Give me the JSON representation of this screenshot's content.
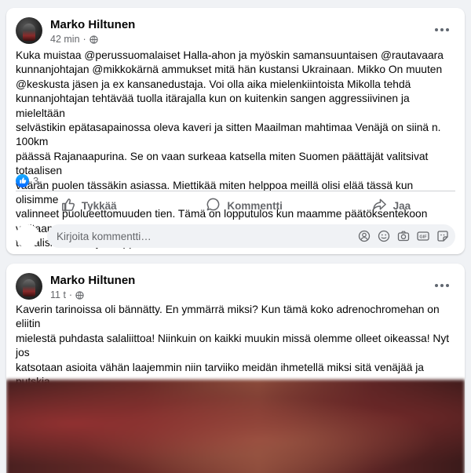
{
  "posts": [
    {
      "author": "Marko Hiltunen",
      "time": "42 min",
      "separator": "·",
      "text": "Kuka muistaa @perussuomalaiset Halla-ahon ja myöskin samansuuntaisen @rautavaara\nkunnanjohtajan @mikkokärnä ammukset mitä hän kustansi Ukrainaan. Mikko On muuten\n@keskusta jäsen ja ex kansanedustaja. Voi olla aika mielenkiintoista Mikolla tehdä\nkunnanjohtajan tehtävää tuolla itärajalla kun on kuitenkin sangen aggressiivinen ja mieleltään\nselvästikin epätasapainossa oleva kaveri ja sitten Maailman mahtimaa Venäjä on siinä n. 100km\npäässä Rajanaapurina. Se on vaan surkeaa katsella miten Suomen päättäjät valitsivat totaalisen\nväärän puolen tässäkin asiassa. Miettikää miten helppoa meillä olisi elää tässä kun olisimme\nvalinneet puolueettomuuden tien. Tämä on lopputulos kun maamme päätöksentekoon valitaan\ntotaalisia idiootteja! Lopputulos on meillä kaikilla nähtävillä!",
      "reaction_count": "3",
      "actions": {
        "like": "Tykkää",
        "comment": "Kommentti",
        "share": "Jaa"
      },
      "comment_placeholder": "Kirjoita kommentti…"
    },
    {
      "author": "Marko Hiltunen",
      "time": "11 t",
      "separator": "·",
      "text": "Kaverin tarinoissa oli bännätty. En ymmärrä miksi? Kun tämä koko adrenochromehan on eliitin\nmielestä puhdasta salaliittoa! Niinkuin on kaikki muukin missä olemme olleet oikeassa! Nyt jos\nkatsotaan asioita vähän laajemmin niin tarviiko meidän ihmetellä miksi sitä venäjää ja putskia\ndissataan niin paljon? Se paljastaa kaikki lännen ja globalistien sairaat harrastukset! Ja tämä\nsama huumehan on yksi niistä syistä miksi venäjä ei katsele hyvällä ukrainankaan touhuja!"
    }
  ],
  "colors": {
    "background": "#f0f2f5",
    "card": "#ffffff",
    "secondary_text": "#65676b",
    "like_blue": "#0866ff"
  },
  "icons": {
    "privacy": "globe-icon",
    "like": "thumbs-up-icon",
    "comment": "speech-bubble-icon",
    "share": "share-arrow-icon",
    "more": "more-options-icon",
    "comment_tools": [
      "avatar-sticker-icon",
      "emoji-icon",
      "camera-icon",
      "gif-icon",
      "sticker-icon"
    ]
  }
}
